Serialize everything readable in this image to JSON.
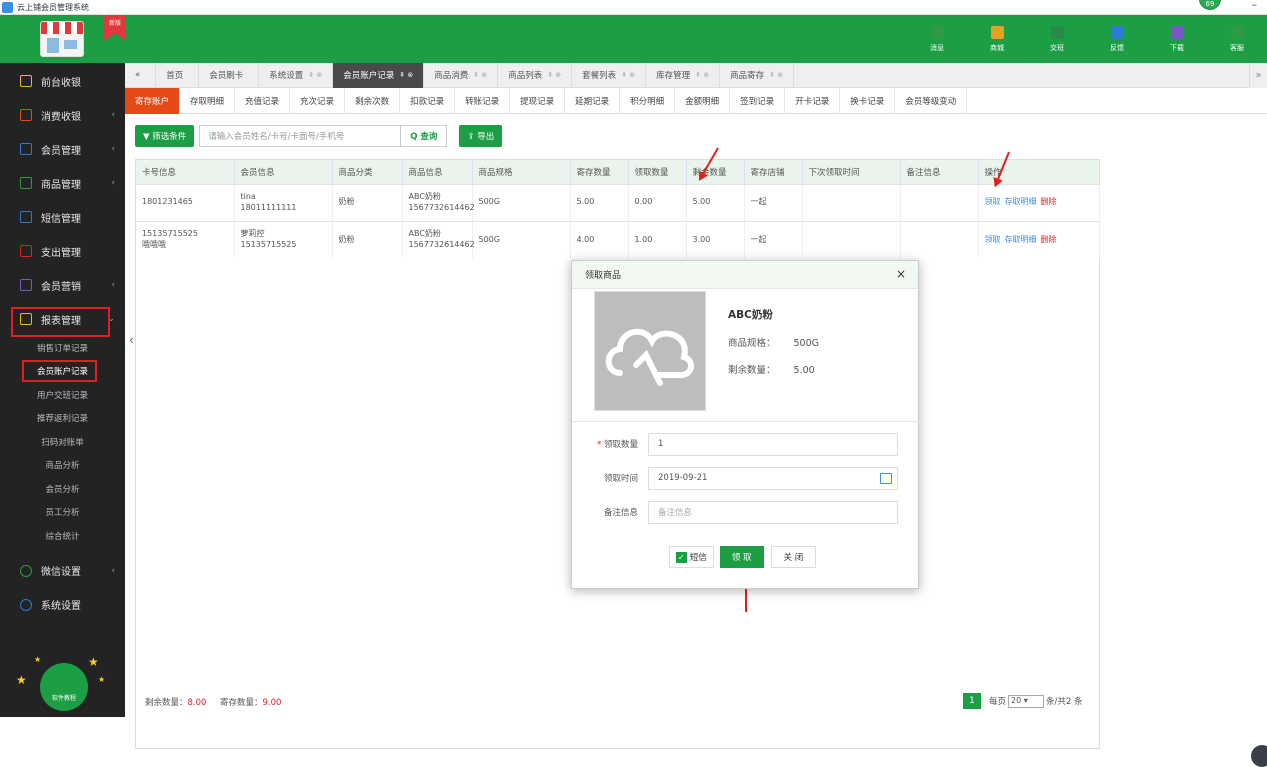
{
  "app": {
    "title": "云上铺会员管理系统",
    "badge": "69",
    "min": "–"
  },
  "brand": {
    "ribbon": "新版"
  },
  "topnav": [
    {
      "label": "消息",
      "icon": "send-icon",
      "color": "#2e9b44"
    },
    {
      "label": "商城",
      "icon": "shop-icon",
      "color": "#e7a021"
    },
    {
      "label": "交班",
      "icon": "swap-icon",
      "color": "#2a8a4b"
    },
    {
      "label": "反馈",
      "icon": "chat-icon",
      "color": "#2b7bd6"
    },
    {
      "label": "下载",
      "icon": "download-icon",
      "color": "#7a56c9"
    },
    {
      "label": "客服",
      "icon": "support-icon",
      "color": "#2e9b44"
    }
  ],
  "sidebar": {
    "items": [
      {
        "label": "前台收银",
        "icon": "cashier-icon",
        "color": "#f0b429",
        "arrow": ""
      },
      {
        "label": "消费收银",
        "icon": "cup-icon",
        "color": "#e64a19",
        "arrow": "‹"
      },
      {
        "label": "会员管理",
        "icon": "members-icon",
        "color": "#2b7bd6",
        "arrow": "‹"
      },
      {
        "label": "商品管理",
        "icon": "goods-icon",
        "color": "#2e9b44",
        "arrow": "‹"
      },
      {
        "label": "短信管理",
        "icon": "sms-icon",
        "color": "#2b7bd6",
        "arrow": ""
      },
      {
        "label": "支出管理",
        "icon": "expense-icon",
        "color": "#e02020",
        "arrow": ""
      },
      {
        "label": "会员营销",
        "icon": "gift-icon",
        "color": "#7a56c9",
        "arrow": "‹"
      },
      {
        "label": "报表管理",
        "icon": "report-icon",
        "color": "#f0b429",
        "arrow": "⌄"
      }
    ],
    "subitems": [
      "销售订单记录",
      "会员账户记录",
      "用户交班记录",
      "推荐返利记录",
      "扫码对账单",
      "商品分析",
      "会员分析",
      "员工分析",
      "综合统计"
    ],
    "bottom": [
      {
        "label": "微信设置",
        "icon": "wechat-icon",
        "color": "#2e9b44",
        "arrow": "‹"
      },
      {
        "label": "系统设置",
        "icon": "settings-icon",
        "color": "#2b7bd6",
        "arrow": ""
      }
    ],
    "help": "软件教程"
  },
  "tabs": [
    {
      "label": "«",
      "tag": ""
    },
    {
      "label": "首页",
      "tag": ""
    },
    {
      "label": "会员刷卡",
      "tag": ""
    },
    {
      "label": "系统设置",
      "tag": "⇞ ⊗"
    },
    {
      "label": "会员账户记录",
      "tag": "⇞ ⊗"
    },
    {
      "label": "商品消费",
      "tag": "⇞ ⊗"
    },
    {
      "label": "商品列表",
      "tag": "⇞ ⊗"
    },
    {
      "label": "套餐列表",
      "tag": "⇞ ⊗"
    },
    {
      "label": "库存管理",
      "tag": "⇞ ⊗"
    },
    {
      "label": "商品寄存",
      "tag": "⇞ ⊗"
    }
  ],
  "tabs_more": "»",
  "subtabs": [
    "寄存账户",
    "存取明细",
    "充值记录",
    "充次记录",
    "剩余次数",
    "扣款记录",
    "转账记录",
    "提现记录",
    "延期记录",
    "积分明细",
    "金额明细",
    "签到记录",
    "开卡记录",
    "换卡记录",
    "会员等级变动"
  ],
  "toolbar": {
    "filter": "▼ 筛选条件",
    "search_placeholder": "请输入会员姓名/卡号/卡面号/手机号",
    "query": "Q 查询",
    "export": "⇪ 导出"
  },
  "table": {
    "headers": [
      "卡号信息",
      "会员信息",
      "商品分类",
      "商品信息",
      "商品规格",
      "寄存数量",
      "领取数量",
      "剩余数量",
      "寄存店铺",
      "下次领取时间",
      "备注信息",
      "操作"
    ],
    "rows": [
      {
        "card": "1801231465",
        "card2": "",
        "member": "tina",
        "member2": "18011111111",
        "cat": "奶粉",
        "goods": "ABC奶粉",
        "goods2": "1567732614462",
        "spec": "500G",
        "stored": "5.00",
        "taken": "0.00",
        "left": "5.00",
        "shop": "一起",
        "next": "",
        "note": ""
      },
      {
        "card": "15135715525",
        "card2": "哦哦哦",
        "member": "萝莉控",
        "member2": "15135715525",
        "cat": "奶粉",
        "goods": "ABC奶粉",
        "goods2": "1567732614462",
        "spec": "500G",
        "stored": "4.00",
        "taken": "1.00",
        "left": "3.00",
        "shop": "一起",
        "next": "",
        "note": ""
      }
    ],
    "actions": {
      "take": "领取",
      "detail": "存取明细",
      "del": "删除"
    }
  },
  "footer": {
    "left_label": "剩余数量：",
    "left_val": "8.00",
    "store_label": "寄存数量：",
    "store_val": "9.00"
  },
  "pager": {
    "page": "1",
    "per_label": "每页",
    "per": "20",
    "total": "条/共2 条"
  },
  "modal": {
    "title": "领取商品",
    "close": "×",
    "product": "ABC奶粉",
    "spec_label": "商品规格：",
    "spec": "500G",
    "left_label": "剩余数量：",
    "left": "5.00",
    "qty_label": "领取数量",
    "qty": "1",
    "date_label": "领取时间",
    "date": "2019-09-21",
    "note_label": "备注信息",
    "note_placeholder": "备注信息",
    "sms": "短信",
    "ok": "领 取",
    "cancel": "关 闭"
  }
}
